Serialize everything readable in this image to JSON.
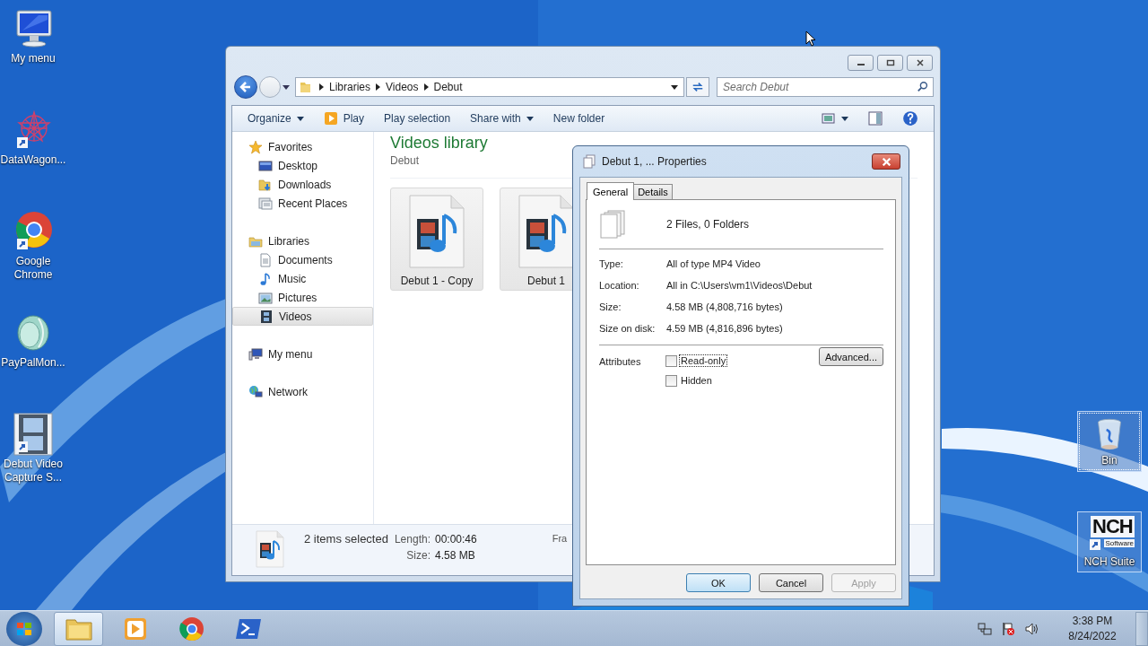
{
  "desktop_icons_left": [
    {
      "label": "My menu",
      "kind": "computer"
    },
    {
      "label": "DataWagon...",
      "kind": "star"
    },
    {
      "label": "Google Chrome",
      "kind": "chrome"
    },
    {
      "label": "PayPalMon...",
      "kind": "coin"
    },
    {
      "label": "Debut Video Capture S...",
      "kind": "film"
    }
  ],
  "desktop_icons_right": [
    {
      "label": "Bin",
      "kind": "bin",
      "focused": true
    },
    {
      "label": "NCH Suite",
      "kind": "nch",
      "focused": false
    }
  ],
  "nch_logo": {
    "brand": "NCH",
    "subtitle": "Software"
  },
  "explorer": {
    "breadcrumbs": [
      "Libraries",
      "Videos",
      "Debut"
    ],
    "search": {
      "placeholder": "Search Debut"
    },
    "toolbar": [
      {
        "label": "Organize",
        "kind": "menu"
      },
      {
        "label": "Play",
        "kind": "play"
      },
      {
        "label": "Play selection",
        "kind": "plain"
      },
      {
        "label": "Share with",
        "kind": "menu"
      },
      {
        "label": "New folder",
        "kind": "plain"
      }
    ],
    "nav": [
      {
        "label": "Favorites",
        "kind": "star",
        "children": [
          {
            "label": "Desktop",
            "kind": "desktop",
            "selected": false
          },
          {
            "label": "Downloads",
            "kind": "download",
            "selected": false
          },
          {
            "label": "Recent Places",
            "kind": "recent",
            "selected": false
          }
        ]
      },
      {
        "label": "Libraries",
        "kind": "library",
        "children": [
          {
            "label": "Documents",
            "kind": "document",
            "selected": false
          },
          {
            "label": "Music",
            "kind": "music",
            "selected": false
          },
          {
            "label": "Pictures",
            "kind": "picture",
            "selected": false
          },
          {
            "label": "Videos",
            "kind": "film",
            "selected": true
          }
        ]
      },
      {
        "label": "My menu",
        "kind": "computer"
      },
      {
        "label": "Network",
        "kind": "network"
      }
    ],
    "library": {
      "title": "Videos library",
      "subtitle": "Debut"
    },
    "files": [
      {
        "name": "Debut 1 - Copy",
        "selected": true
      },
      {
        "name": "Debut 1",
        "selected": true
      }
    ],
    "details": {
      "summary": "2 items selected",
      "fields": [
        {
          "label": "Length:",
          "value": "00:00:46"
        },
        {
          "label": "Size:",
          "value": "4.58 MB"
        }
      ],
      "column_2": "Fra"
    }
  },
  "properties": {
    "title": "Debut 1, ... Properties",
    "tabs": [
      {
        "label": "General",
        "selected": true
      },
      {
        "label": "Details",
        "selected": false
      }
    ],
    "summary": "2 Files, 0 Folders",
    "rows": [
      {
        "label": "Type:",
        "value": "All of type MP4 Video"
      },
      {
        "label": "Location:",
        "value": "All in C:\\Users\\vm1\\Videos\\Debut"
      },
      {
        "label": "Size:",
        "value": "4.58 MB (4,808,716 bytes)"
      },
      {
        "label": "Size on disk:",
        "value": "4.59 MB (4,816,896 bytes)"
      }
    ],
    "attributes_label": "Attributes",
    "checkboxes": [
      {
        "label": "Read-only",
        "checked": false,
        "focused": true
      },
      {
        "label": "Hidden",
        "checked": false,
        "focused": false
      }
    ],
    "advanced_button": "Advanced...",
    "buttons": [
      {
        "label": "OK",
        "kind": "default",
        "disabled": false
      },
      {
        "label": "Cancel",
        "kind": "normal",
        "disabled": false
      },
      {
        "label": "Apply",
        "kind": "normal",
        "disabled": true
      }
    ]
  },
  "taskbar": {
    "apps": [
      {
        "kind": "explorer",
        "active": true
      },
      {
        "kind": "player",
        "active": false
      },
      {
        "kind": "chrome",
        "active": false
      },
      {
        "kind": "shell",
        "active": false
      }
    ],
    "time": "3:38 PM",
    "date": "8/24/2022"
  }
}
